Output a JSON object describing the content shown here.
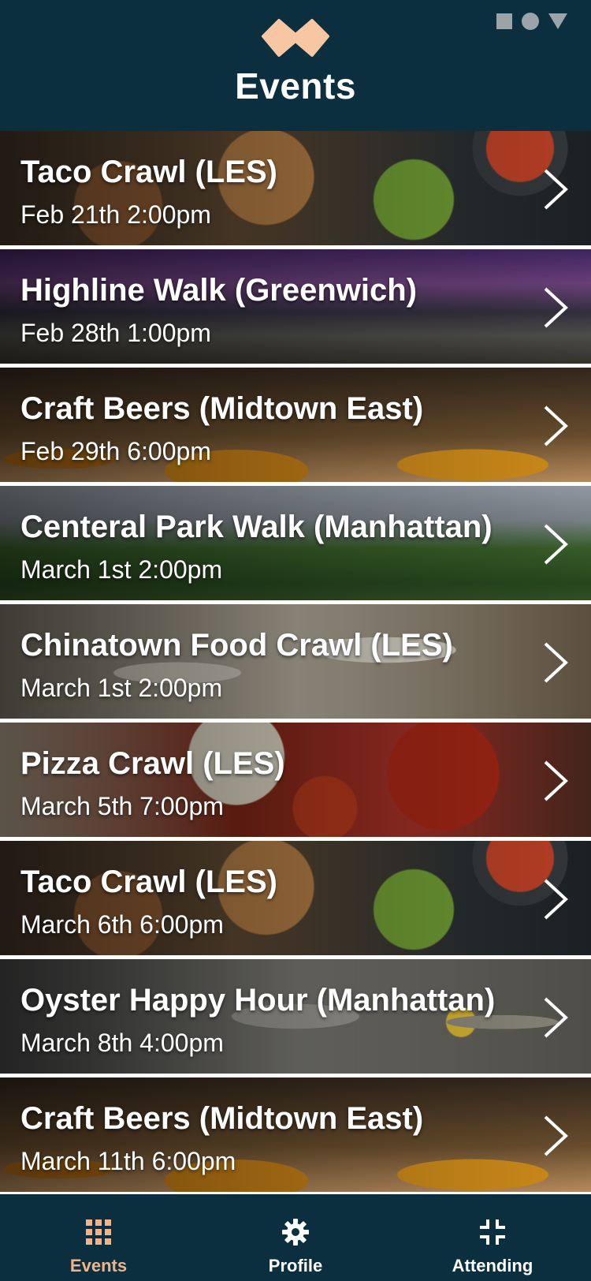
{
  "header": {
    "title": "Events",
    "logo_icon": "infinity-logo-icon",
    "logo_color": "#f7c7a3",
    "background": "#0b2f3f"
  },
  "status_bar": {
    "icons": [
      "square-icon",
      "circle-icon",
      "triangle-icon"
    ],
    "color": "#9aa4a9"
  },
  "events": [
    {
      "title": "Taco Crawl (LES)",
      "date": "Feb 21th 2:00pm",
      "theme": "taco"
    },
    {
      "title": "Highline Walk (Greenwich)",
      "date": "Feb 28th 1:00pm",
      "theme": "highline"
    },
    {
      "title": "Craft Beers (Midtown East)",
      "date": "Feb 29th 6:00pm",
      "theme": "beer"
    },
    {
      "title": "Centeral Park Walk (Manhattan)",
      "date": "March 1st 2:00pm",
      "theme": "park"
    },
    {
      "title": "Chinatown Food Crawl (LES)",
      "date": "March 1st 2:00pm",
      "theme": "dumpling"
    },
    {
      "title": "Pizza Crawl (LES)",
      "date": "March 5th 7:00pm",
      "theme": "pizza"
    },
    {
      "title": "Taco Crawl (LES)",
      "date": "March 6th 6:00pm",
      "theme": "taco"
    },
    {
      "title": "Oyster Happy Hour (Manhattan)",
      "date": "March 8th 4:00pm",
      "theme": "oyster"
    },
    {
      "title": "Craft Beers (Midtown East)",
      "date": "March 11th 6:00pm",
      "theme": "beer"
    }
  ],
  "tabbar": {
    "tabs": [
      {
        "label": "Events",
        "icon": "grid-icon",
        "active": true
      },
      {
        "label": "Profile",
        "icon": "gear-icon",
        "active": false
      },
      {
        "label": "Attending",
        "icon": "collapse-icon",
        "active": false
      }
    ],
    "active_color": "#f0b48a",
    "inactive_color": "#ffffff"
  }
}
